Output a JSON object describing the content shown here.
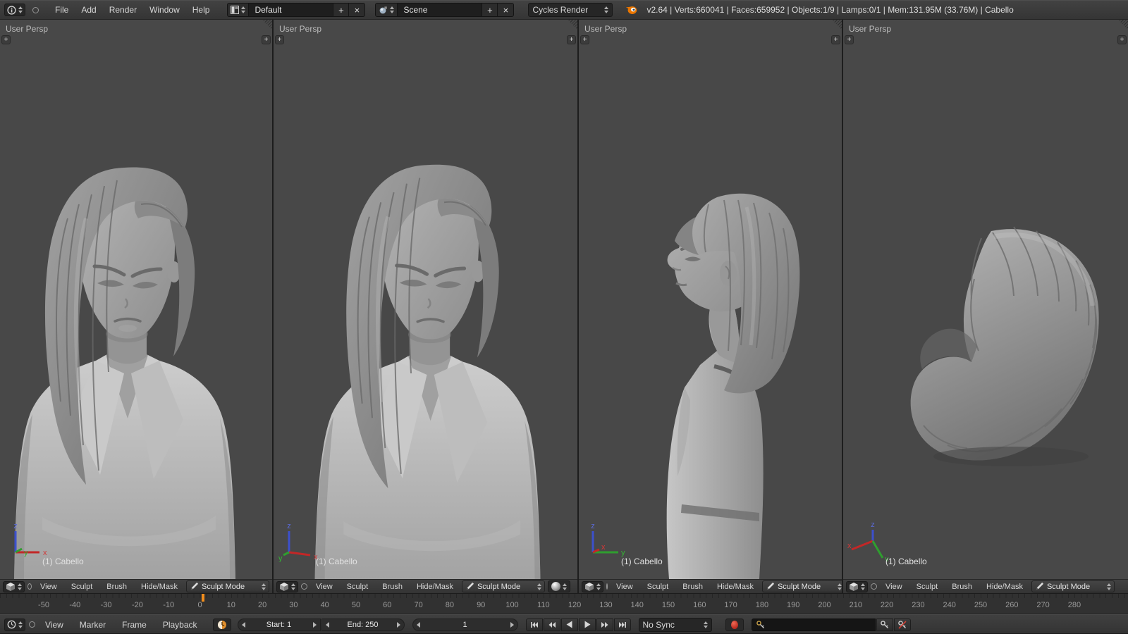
{
  "app": {
    "stats": "v2.64 | Verts:660041 | Faces:659952 | Objects:1/9 | Lamps:0/1 | Mem:131.95M (33.76M) | Cabello"
  },
  "top_header": {
    "menus": [
      "File",
      "Add",
      "Render",
      "Window",
      "Help"
    ],
    "layout": {
      "value": "Default",
      "add": "+",
      "close": "×"
    },
    "scene": {
      "value": "Scene",
      "add": "+",
      "close": "×"
    },
    "engine": {
      "value": "Cycles Render"
    }
  },
  "viewport_common": {
    "view_label": "User Persp",
    "object_label": "(1) Cabello",
    "menus": [
      "View",
      "Sculpt",
      "Brush",
      "Hide/Mask"
    ],
    "mode": "Sculpt Mode",
    "plus": "+"
  },
  "gizmo": {
    "x": "x",
    "y": "y",
    "z": "z"
  },
  "timeline": {
    "menus": [
      "View",
      "Marker",
      "Frame",
      "Playback"
    ],
    "start": "Start: 1",
    "end": "End: 250",
    "frame": "1",
    "sync": "No Sync",
    "ruler_labels": [
      "-50",
      "-40",
      "-30",
      "-20",
      "-10",
      "0",
      "10",
      "20",
      "30",
      "40",
      "50",
      "60",
      "70",
      "80",
      "90",
      "100",
      "110",
      "120",
      "130",
      "140",
      "150",
      "160",
      "170",
      "180",
      "190",
      "200",
      "210",
      "220",
      "230",
      "240",
      "250",
      "260",
      "270",
      "280"
    ],
    "current_frame": 1
  },
  "colors": {
    "accent": "#f08c1c",
    "record": "#b92b20"
  }
}
